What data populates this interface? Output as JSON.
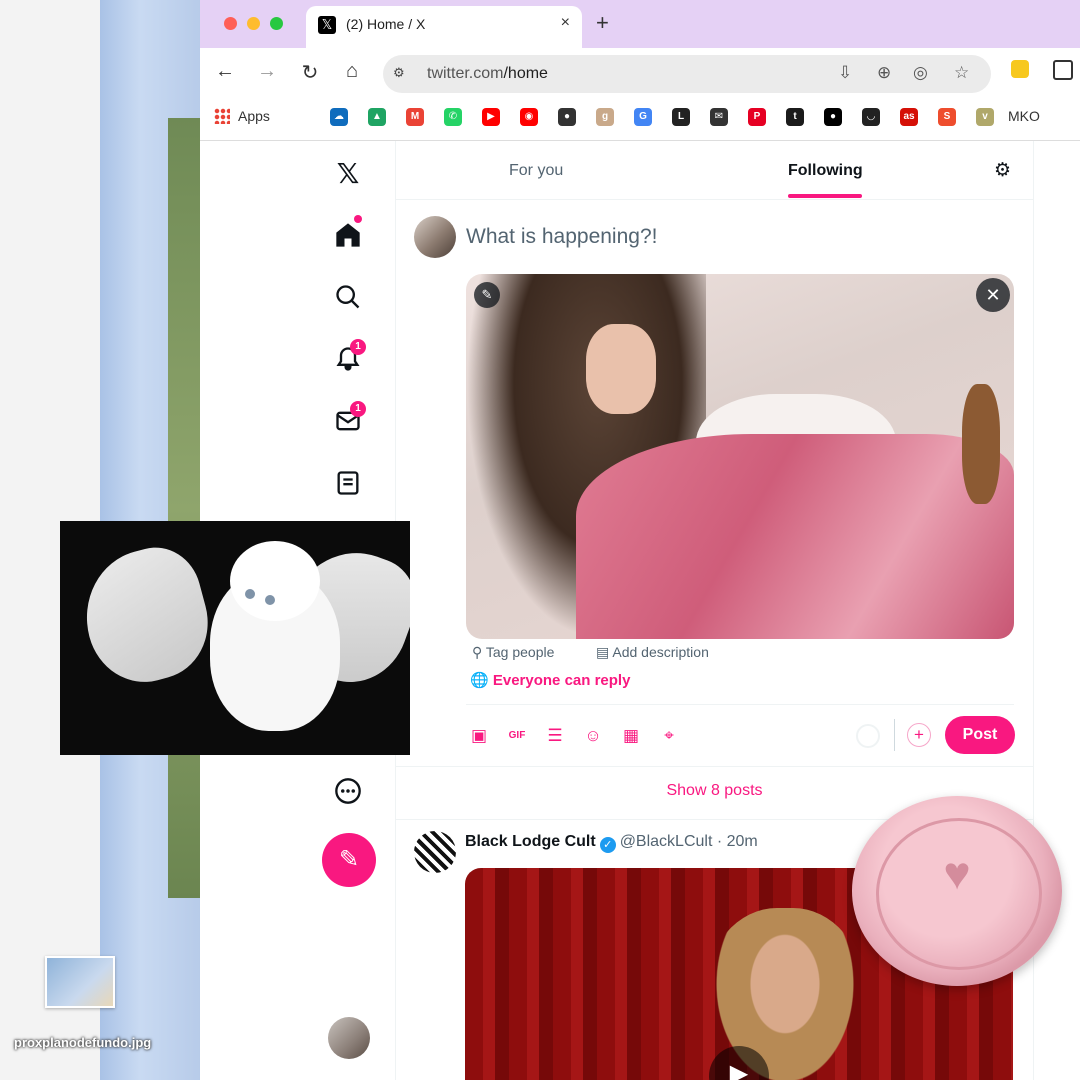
{
  "browser": {
    "tab_title": "(2) Home / X",
    "tab_close": "×",
    "new_tab": "+",
    "favicon": "𝕏",
    "url_domain": "twitter.com",
    "url_path": "/home",
    "bookmarks_apps_label": "Apps",
    "bookmarks_last_label": "MKO",
    "bookmarks": [
      {
        "icon": "onedrive-icon",
        "color": "#0f6cbd",
        "glyph": "☁"
      },
      {
        "icon": "drive-icon",
        "color": "#1fa463",
        "glyph": "▲"
      },
      {
        "icon": "gmail-icon",
        "color": "#ea4335",
        "glyph": "M"
      },
      {
        "icon": "whatsapp-icon",
        "color": "#25d366",
        "glyph": "✆"
      },
      {
        "icon": "youtube-icon",
        "color": "#ff0000",
        "glyph": "▶"
      },
      {
        "icon": "youtube-music-icon",
        "color": "#ff0000",
        "glyph": "◉"
      },
      {
        "icon": "colors-icon",
        "color": "#333333",
        "glyph": "●"
      },
      {
        "icon": "goodreads-icon",
        "color": "#c9a98a",
        "glyph": "g"
      },
      {
        "icon": "translate-icon",
        "color": "#4285f4",
        "glyph": "G"
      },
      {
        "icon": "letterboxd-icon",
        "color": "#222222",
        "glyph": "L"
      },
      {
        "icon": "mail-icon",
        "color": "#333333",
        "glyph": "✉"
      },
      {
        "icon": "pinterest-icon",
        "color": "#e60023",
        "glyph": "P"
      },
      {
        "icon": "tumblr-icon",
        "color": "#1b1b1b",
        "glyph": "t"
      },
      {
        "icon": "medium-icon",
        "color": "#000000",
        "glyph": "●"
      },
      {
        "icon": "deezer-icon",
        "color": "#222222",
        "glyph": "◡"
      },
      {
        "icon": "lastfm-icon",
        "color": "#d51007",
        "glyph": "as"
      },
      {
        "icon": "shopee-icon",
        "color": "#ee4d2d",
        "glyph": "S"
      },
      {
        "icon": "vts-icon",
        "color": "#b0a86a",
        "glyph": "v"
      },
      {
        "icon": "mko-icon",
        "color": "#333333",
        "glyph": "M"
      }
    ],
    "colors": {
      "titlebar": "#e5d1f5",
      "accent": "#f91880"
    }
  },
  "x": {
    "logo": "𝕏",
    "nav_icons": [
      "home-icon",
      "search-icon",
      "notifications-icon",
      "messages-icon",
      "lists-icon",
      "more-icon"
    ],
    "notifications_badge": "1",
    "messages_badge": "1",
    "tabs": [
      {
        "label": "For you",
        "active": false
      },
      {
        "label": "Following",
        "active": true
      }
    ],
    "composer": {
      "placeholder": "What is happening?!",
      "tag_people": "Tag people",
      "add_description": "Add description",
      "reply_setting": "Everyone can reply",
      "post_label": "Post"
    },
    "show_posts": "Show 8 posts",
    "tweet": {
      "name": "Black Lodge Cult",
      "handle": "@BlackLCult",
      "time": "· 20m"
    }
  },
  "desktop": {
    "file_name": "proxplanodefundo.jpg"
  }
}
